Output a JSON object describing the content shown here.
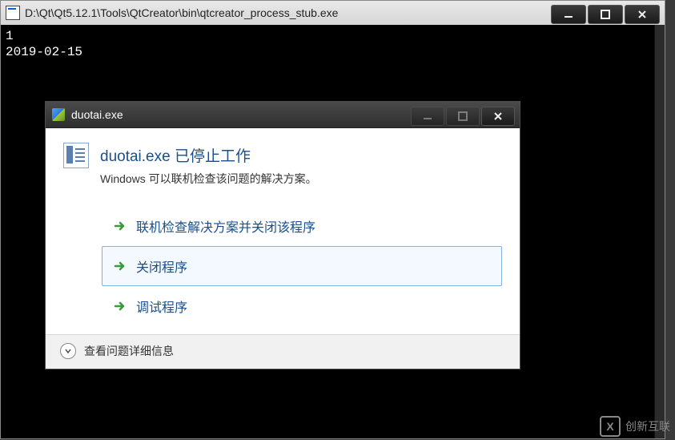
{
  "console": {
    "title": "D:\\Qt\\Qt5.12.1\\Tools\\QtCreator\\bin\\qtcreator_process_stub.exe",
    "lines": [
      "1",
      "2019-02-15"
    ]
  },
  "dialog": {
    "window_title": "duotai.exe",
    "heading": "duotai.exe 已停止工作",
    "subtext": "Windows 可以联机检查该问题的解决方案。",
    "actions": {
      "check_online": "联机检查解决方案并关闭该程序",
      "close_program": "关闭程序",
      "debug_program": "调试程序"
    },
    "details_label": "查看问题详细信息"
  },
  "watermark": {
    "text": "创新互联",
    "badge": "X"
  }
}
